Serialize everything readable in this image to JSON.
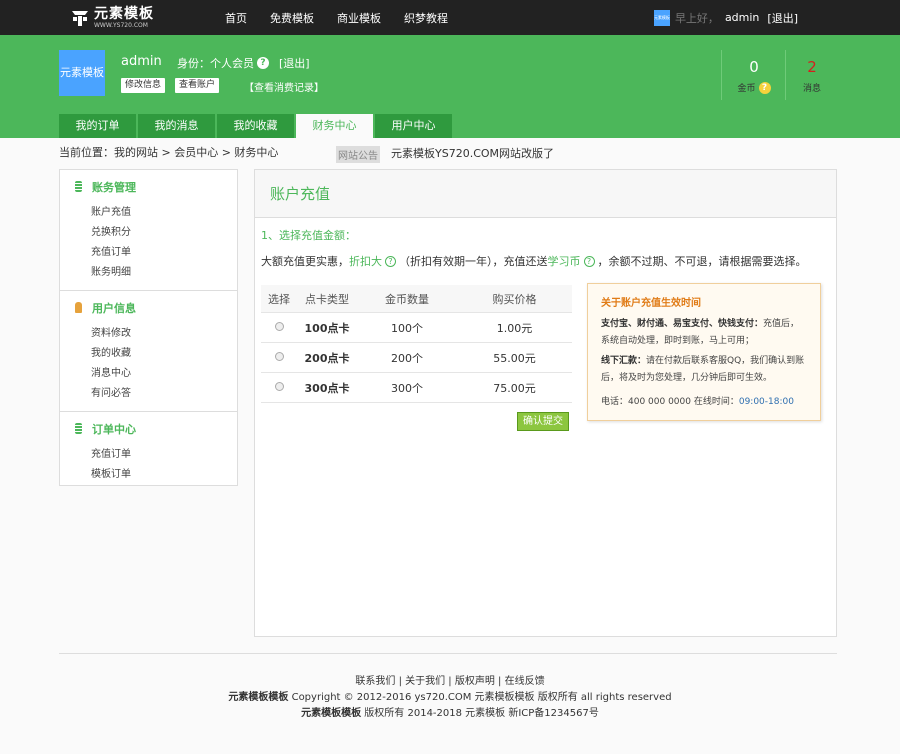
{
  "top": {
    "logo_name": "元素模板",
    "logo_url": "WWW.YS720.COM",
    "nav": [
      "首页",
      "免费模板",
      "商业模板",
      "织梦教程"
    ],
    "avatar_text": "元素模板",
    "greeting": "早上好，",
    "username": "admin",
    "logout": "[退出]"
  },
  "header": {
    "avatar_text": "元素模板",
    "name": "admin",
    "role": "身份：个人会员",
    "logout": "[退出]",
    "edit_btn": "修改信息",
    "account_btn": "查看账户",
    "record_link": "【查看消费记录】",
    "coins": "0",
    "coins_label": "金币",
    "messages": "2",
    "messages_label": "消息"
  },
  "tabs": [
    "我的订单",
    "我的消息",
    "我的收藏",
    "财务中心",
    "用户中心"
  ],
  "breadcrumb": "当前位置：我的网站 > 会员中心 > 财务中心",
  "notice": {
    "tag": "网站公告",
    "text": "元素模板YS720.COM网站改版了"
  },
  "sidebar": [
    {
      "title": "账务管理",
      "items": [
        "账户充值",
        "兑换积分",
        "充值订单",
        "账务明细"
      ]
    },
    {
      "title": "用户信息",
      "items": [
        "资料修改",
        "我的收藏",
        "消息中心",
        "有问必答"
      ]
    },
    {
      "title": "订单中心",
      "items": [
        "充值订单",
        "模板订单"
      ]
    }
  ],
  "main": {
    "title": "账户充值",
    "step": "1、选择充值金额：",
    "desc_a": "大额充值更实惠，",
    "desc_hl1": "折扣大",
    "desc_b": "（折扣有效期一年），充值还送",
    "desc_hl2": "学习币",
    "desc_c": "，余额不过期、不可退，请根据需要选择。",
    "columns": [
      "选择",
      "点卡类型",
      "金币数量",
      "购买价格"
    ],
    "rows": [
      {
        "type": "100点卡",
        "amount": "100个",
        "price": "1.00元"
      },
      {
        "type": "200点卡",
        "amount": "200个",
        "price": "55.00元"
      },
      {
        "type": "300点卡",
        "amount": "300个",
        "price": "75.00元"
      }
    ],
    "submit": "确认提交"
  },
  "info": {
    "title": "关于账户充值生效时间",
    "p1_bold": "支付宝、财付通、易宝支付、快钱支付：",
    "p1": "充值后，系统自动处理，即时到账，马上可用；",
    "p2_bold": "线下汇款：",
    "p2": "请在付款后联系客服QQ，我们确认到账后，将及时为您处理，几分钟后即可生效。",
    "phone": "电话：400 000 0000  在线时间：",
    "hours": "09:00-18:00"
  },
  "footer": {
    "links": "联系我们 | 关于我们 | 版权声明 | 在线反馈",
    "brand1": "元素模板模板",
    "line2": " Copyright © 2012-2016 ys720.COM 元素模板模板 版权所有 all rights reserved",
    "brand2": "元素模板模板",
    "line3": " 版权所有 2014-2018 元素模板 新ICP备1234567号"
  }
}
